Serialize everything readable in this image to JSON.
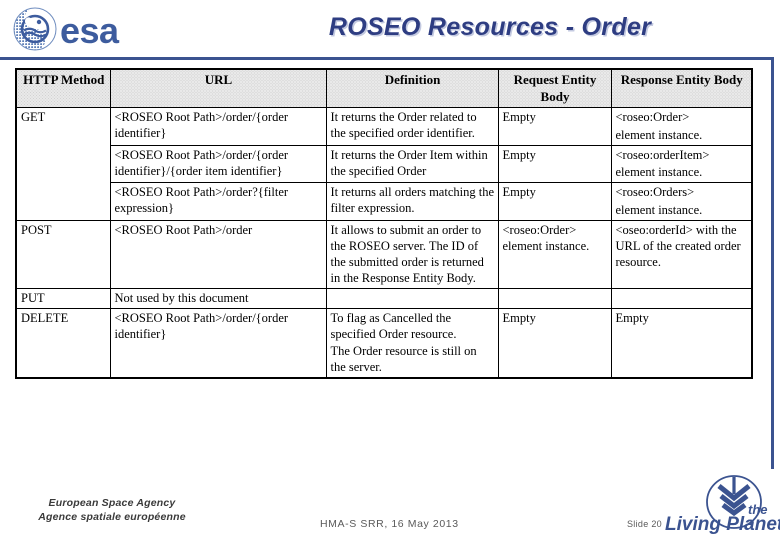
{
  "header": {
    "title": "ROSEO Resources - Order",
    "logo_alt": "esa",
    "logo_text": "esa"
  },
  "table": {
    "columns": [
      {
        "key": "method",
        "label": "HTTP Method"
      },
      {
        "key": "url",
        "label": "URL"
      },
      {
        "key": "def",
        "label": "Definition"
      },
      {
        "key": "request",
        "label": "Request Entity Body"
      },
      {
        "key": "response",
        "label": "Response Entity Body"
      }
    ],
    "rows": [
      {
        "method": "GET",
        "url": "<ROSEO Root Path>/order/{order identifier}",
        "def": "It returns the Order related to the specified order identifier.",
        "request": "Empty",
        "response_lines": [
          "<roseo:Order>",
          "element instance."
        ]
      },
      {
        "method": "",
        "url": "<ROSEO Root Path>/order/{order identifier}/{order item identifier}",
        "def": "It returns the Order Item within the specified Order",
        "request": "Empty",
        "response_lines": [
          "<roseo:orderItem>",
          "element instance."
        ]
      },
      {
        "method": "",
        "url": "<ROSEO Root Path>/order?{filter expression}",
        "def": "It returns all orders matching the filter expression.",
        "request": "Empty",
        "response_lines": [
          "<roseo:Orders>",
          "element instance."
        ]
      },
      {
        "method": "POST",
        "url": "<ROSEO Root Path>/order",
        "def": "It allows to submit an order to the ROSEO server. The ID of the submitted order is returned in the Response Entity Body.",
        "request": "<roseo:Order> element instance.",
        "response_lines": [
          "<oseo:orderId> with the URL of the created order resource."
        ]
      },
      {
        "method": "PUT",
        "url": "Not used by this document",
        "def": "",
        "request": "",
        "response_lines": [
          ""
        ]
      },
      {
        "method": "DELETE",
        "url": "<ROSEO Root Path>/order/{order identifier}",
        "def_lines": [
          "To flag as Cancelled the specified Order resource.",
          "The Order resource is still on the server."
        ],
        "request": "Empty",
        "response_lines": [
          "Empty"
        ]
      }
    ]
  },
  "footer": {
    "agency_line1": "European Space Agency",
    "agency_line2": "Agence spatiale européenne",
    "event": "HMA-S SRR, 16 May 2013",
    "slide": "Slide 20",
    "living_planet_the": "the",
    "living_planet_name": "Living Planet"
  },
  "colors": {
    "title_blue": "#2e3d82",
    "rule_blue": "#3b5390",
    "logo_blue": "#3d5c9e",
    "header_fill": "#e9e9e9"
  }
}
